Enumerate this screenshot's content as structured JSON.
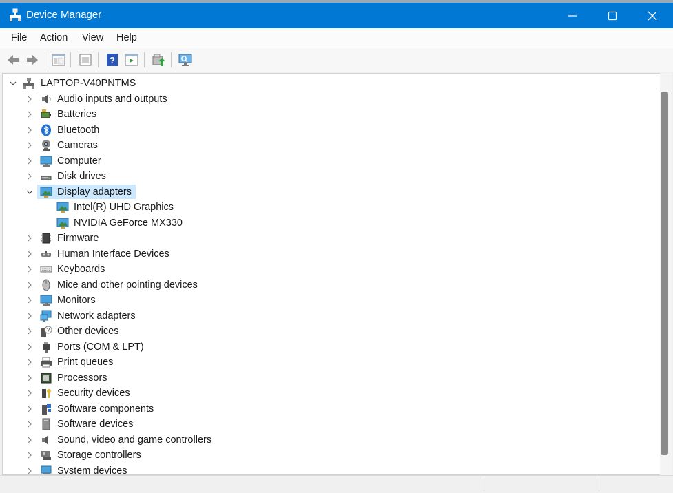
{
  "window": {
    "title": "Device Manager"
  },
  "menubar": {
    "items": [
      "File",
      "Action",
      "View",
      "Help"
    ]
  },
  "toolbar": {
    "buttons": [
      "back-arrow-icon",
      "forward-arrow-icon",
      "show-hide-console-tree-icon",
      "properties-icon",
      "help-icon",
      "action-pane-icon",
      "update-driver-icon",
      "scan-hardware-icon"
    ]
  },
  "tree": {
    "root": "LAPTOP-V40PNTMS",
    "items": [
      {
        "label": "Audio inputs and outputs",
        "icon": "speaker-icon"
      },
      {
        "label": "Batteries",
        "icon": "battery-icon"
      },
      {
        "label": "Bluetooth",
        "icon": "bluetooth-icon"
      },
      {
        "label": "Cameras",
        "icon": "camera-icon"
      },
      {
        "label": "Computer",
        "icon": "computer-icon"
      },
      {
        "label": "Disk drives",
        "icon": "disk-drive-icon"
      },
      {
        "label": "Display adapters",
        "icon": "display-adapter-icon",
        "expanded": true,
        "selected": true,
        "children": [
          "Intel(R) UHD Graphics",
          "NVIDIA GeForce MX330"
        ]
      },
      {
        "label": "Firmware",
        "icon": "firmware-chip-icon"
      },
      {
        "label": "Human Interface Devices",
        "icon": "hid-icon"
      },
      {
        "label": "Keyboards",
        "icon": "keyboard-icon"
      },
      {
        "label": "Mice and other pointing devices",
        "icon": "mouse-icon"
      },
      {
        "label": "Monitors",
        "icon": "monitor-icon"
      },
      {
        "label": "Network adapters",
        "icon": "network-adapter-icon"
      },
      {
        "label": "Other devices",
        "icon": "unknown-device-icon"
      },
      {
        "label": "Ports (COM & LPT)",
        "icon": "port-icon"
      },
      {
        "label": "Print queues",
        "icon": "printer-icon"
      },
      {
        "label": "Processors",
        "icon": "processor-icon"
      },
      {
        "label": "Security devices",
        "icon": "security-key-icon"
      },
      {
        "label": "Software components",
        "icon": "software-component-icon"
      },
      {
        "label": "Software devices",
        "icon": "software-device-icon"
      },
      {
        "label": "Sound, video and game controllers",
        "icon": "sound-controller-icon"
      },
      {
        "label": "Storage controllers",
        "icon": "storage-controller-icon"
      },
      {
        "label": "System devices",
        "icon": "system-device-icon"
      }
    ]
  },
  "colors": {
    "titlebar": "#0078d4",
    "selection": "#cce8ff"
  }
}
